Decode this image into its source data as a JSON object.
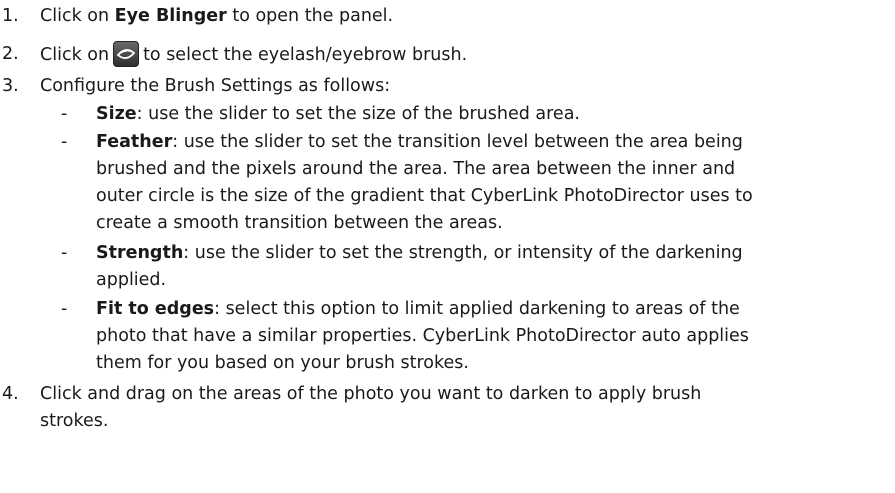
{
  "steps": [
    {
      "num": "1.",
      "pre": "Click on ",
      "bold": "Eye Blinger",
      "post": " to open the panel."
    },
    {
      "num": "2.",
      "pre": "Click on",
      "icon": "eyelash-brush-icon",
      "post": "to select the eyelash/eyebrow brush."
    },
    {
      "num": "3.",
      "text": "Configure the Brush Settings as follows:"
    },
    {
      "num": "4.",
      "line1": "Click and drag on the areas of the photo you want to darken to apply brush",
      "line2": "strokes."
    }
  ],
  "settings": [
    {
      "dash": "-",
      "label": "Size",
      "lines": [
        ": use the slider to set the size of the brushed area."
      ]
    },
    {
      "dash": "-",
      "label": "Feather",
      "lines": [
        ": use the slider to set the transition level between the area being",
        "brushed and the pixels around the area. The area between the inner and",
        "outer circle is the size of the gradient that CyberLink PhotoDirector uses to",
        "create a smooth transition between the areas."
      ]
    },
    {
      "dash": "-",
      "label": "Strength",
      "lines": [
        ": use the slider to set the strength, or intensity of the darkening",
        "applied."
      ]
    },
    {
      "dash": "-",
      "label": "Fit to edges",
      "lines": [
        ": select this option to limit applied darkening to areas of the",
        "photo that have a similar properties. CyberLink PhotoDirector auto applies",
        "them for you based on your brush strokes."
      ]
    }
  ]
}
